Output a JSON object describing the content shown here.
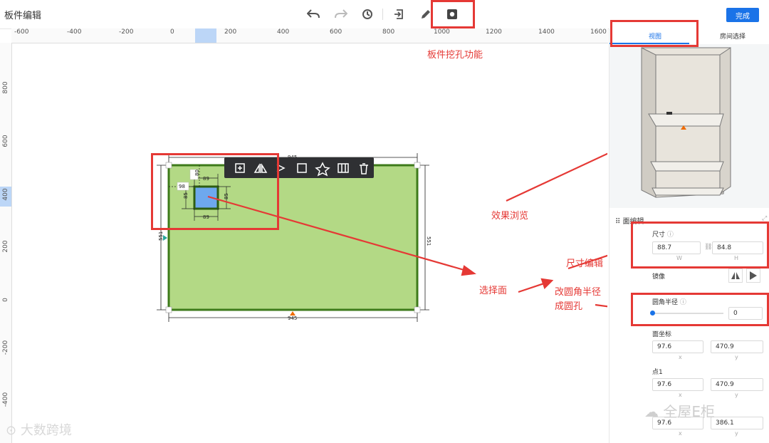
{
  "header": {
    "title": "板件编辑",
    "done_label": "完成"
  },
  "toolbar": {
    "icons": [
      "undo-icon",
      "redo-icon",
      "history-icon",
      "import-icon",
      "pen-icon",
      "hole-cut-icon"
    ]
  },
  "ruler": {
    "h_ticks": [
      "-600",
      "-400",
      "-200",
      "0",
      "200",
      "400",
      "600",
      "800",
      "1000",
      "1200",
      "1400",
      "1600"
    ],
    "v_ticks": [
      "800",
      "600",
      "400",
      "200",
      "0",
      "-200",
      "-400"
    ]
  },
  "board": {
    "width_top": "945",
    "width_bottom": "945",
    "height_left": "551",
    "height_right": "551",
    "hole": {
      "offset_left": "98",
      "offset_top": "80",
      "w_top": "89",
      "w_bottom": "89",
      "h_left": "85",
      "h_right": "85"
    }
  },
  "float_toolbar": {
    "icons": [
      "add-copy-icon",
      "mirror-icon",
      "flip-icon",
      "rect-icon",
      "star-icon",
      "array-icon",
      "delete-icon"
    ]
  },
  "panel": {
    "tabs": [
      "视图",
      "房间选择"
    ],
    "section_title": "面编辑",
    "size": {
      "label": "尺寸",
      "w": "88.7",
      "h": "84.8",
      "w_sub": "W",
      "h_sub": "H"
    },
    "mirror": {
      "label": "镜像"
    },
    "radius": {
      "label": "圆角半径",
      "value": "0",
      "slider_fraction": 0
    },
    "face_coord": {
      "label": "面坐标",
      "x": "97.6",
      "y": "470.9",
      "x_sub": "x",
      "y_sub": "y"
    },
    "point1": {
      "label": "点1",
      "x": "97.6",
      "y": "470.9",
      "x_sub": "x",
      "y_sub": "y"
    },
    "point2": {
      "x": "97.6",
      "y": "386.1",
      "x_sub": "x",
      "y_sub": "y"
    }
  },
  "annotations": {
    "hole_feature": "板件挖孔功能",
    "preview": "效果浏览",
    "size_edit": "尺寸编辑",
    "select_face": "选择面",
    "radius_line1": "改圆角半径",
    "radius_line2": "成圆孔"
  },
  "watermarks": {
    "left": "大数跨境",
    "right": "全屋E柜"
  },
  "colors": {
    "board_fill": "#b3d985",
    "board_border": "#3d7a1a",
    "hole_fill": "#6ea8ee",
    "accent": "#1a73e8",
    "annotation": "#e53935"
  }
}
